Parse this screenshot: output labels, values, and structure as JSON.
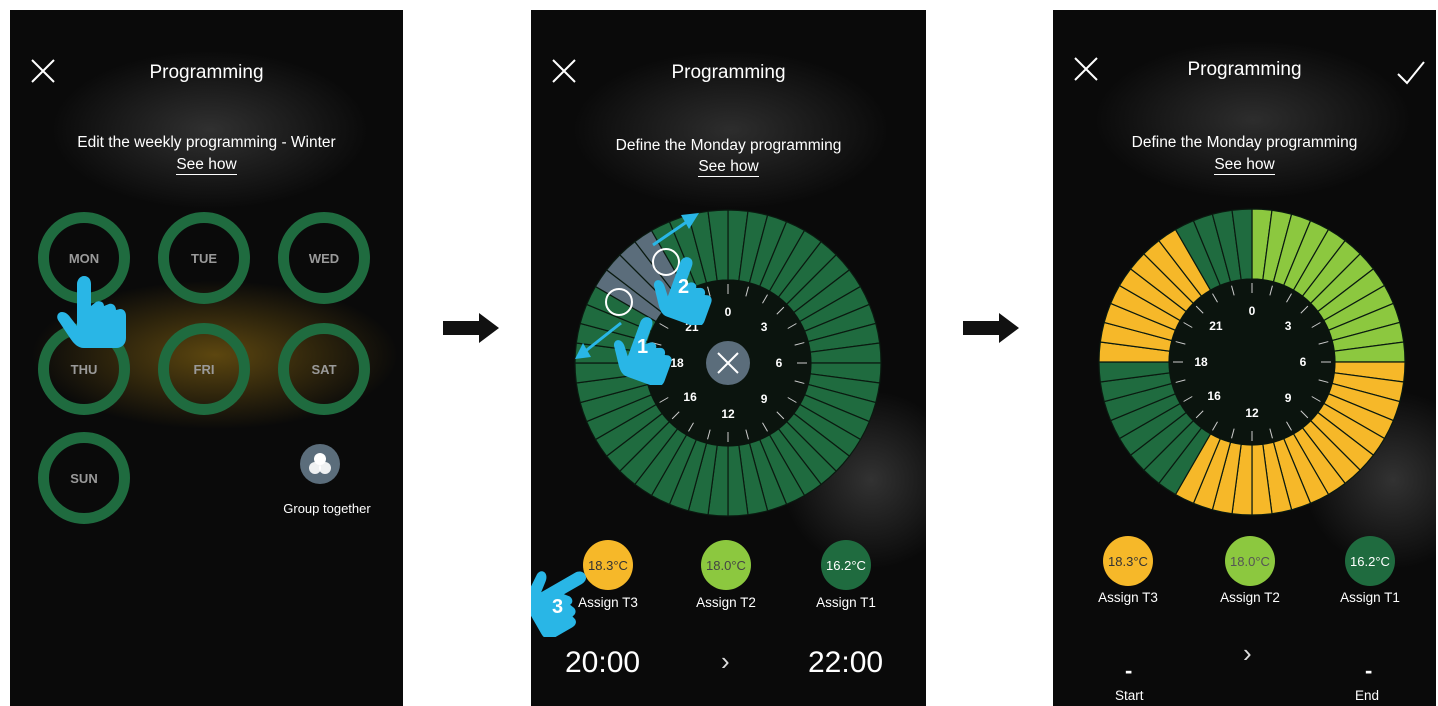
{
  "screens": [
    {
      "title": "Programming",
      "subtitle": "Edit the weekly programming - Winter",
      "see_how": "See how",
      "days": [
        "MON",
        "TUE",
        "WED",
        "THU",
        "FRI",
        "SAT",
        "SUN"
      ],
      "group_label": "Group together"
    },
    {
      "title": "Programming",
      "subtitle": "Define the Monday programming",
      "see_how": "See how",
      "hours": [
        "0",
        "3",
        "6",
        "9",
        "12",
        "16",
        "18",
        "21"
      ],
      "temps": [
        {
          "value": "18.3°C",
          "label": "Assign T3",
          "color": "#f6b829"
        },
        {
          "value": "18.0°C",
          "label": "Assign T2",
          "color": "#8cc83f"
        },
        {
          "value": "16.2°C",
          "label": "Assign T1",
          "color": "#1f6b3f"
        }
      ],
      "start_time": "20:00",
      "end_time": "22:00",
      "step_labels": [
        "1",
        "2",
        "3"
      ]
    },
    {
      "title": "Programming",
      "subtitle": "Define the Monday programming",
      "see_how": "See how",
      "hours": [
        "0",
        "3",
        "6",
        "9",
        "12",
        "16",
        "18",
        "21"
      ],
      "temps": [
        {
          "value": "18.3°C",
          "label": "Assign T3",
          "color": "#f6b829"
        },
        {
          "value": "18.0°C",
          "label": "Assign T2",
          "color": "#8cc83f"
        },
        {
          "value": "16.2°C",
          "label": "Assign T1",
          "color": "#1f6b3f"
        }
      ],
      "start_value": "-",
      "end_value": "-",
      "start_label": "Start",
      "end_label": "End"
    }
  ],
  "wheel2_segments": [
    "T1",
    "T1",
    "T1",
    "T1",
    "T1",
    "T1",
    "T1",
    "T1",
    "T1",
    "T1",
    "T1",
    "T1",
    "T1",
    "T1",
    "T1",
    "T1",
    "T1",
    "T1",
    "T1",
    "T1",
    "T1",
    "T1",
    "T1",
    "T1",
    "T1",
    "T1",
    "T1",
    "T1",
    "T1",
    "T1",
    "T1",
    "T1",
    "T1",
    "T1",
    "T1",
    "T1",
    "T1",
    "T1",
    "T1",
    "T1",
    "sel",
    "sel",
    "sel",
    "sel",
    "T1",
    "T1",
    "T1",
    "T1"
  ],
  "wheel3_segments": [
    "T2",
    "T2",
    "T2",
    "T2",
    "T2",
    "T2",
    "T2",
    "T2",
    "T2",
    "T2",
    "T2",
    "T2",
    "T3",
    "T3",
    "T3",
    "T3",
    "T3",
    "T3",
    "T3",
    "T3",
    "T3",
    "T3",
    "T3",
    "T3",
    "T3",
    "T3",
    "T3",
    "T3",
    "T1",
    "T1",
    "T1",
    "T1",
    "T1",
    "T1",
    "T1",
    "T1",
    "T3",
    "T3",
    "T3",
    "T3",
    "T3",
    "T3",
    "T3",
    "T3",
    "T1",
    "T1",
    "T1",
    "T1"
  ],
  "colors": {
    "T1": "#1f6b3f",
    "T2": "#8cc83f",
    "T3": "#f6b829",
    "sel": "#5b6d7b",
    "accent": "#29b6e6"
  }
}
